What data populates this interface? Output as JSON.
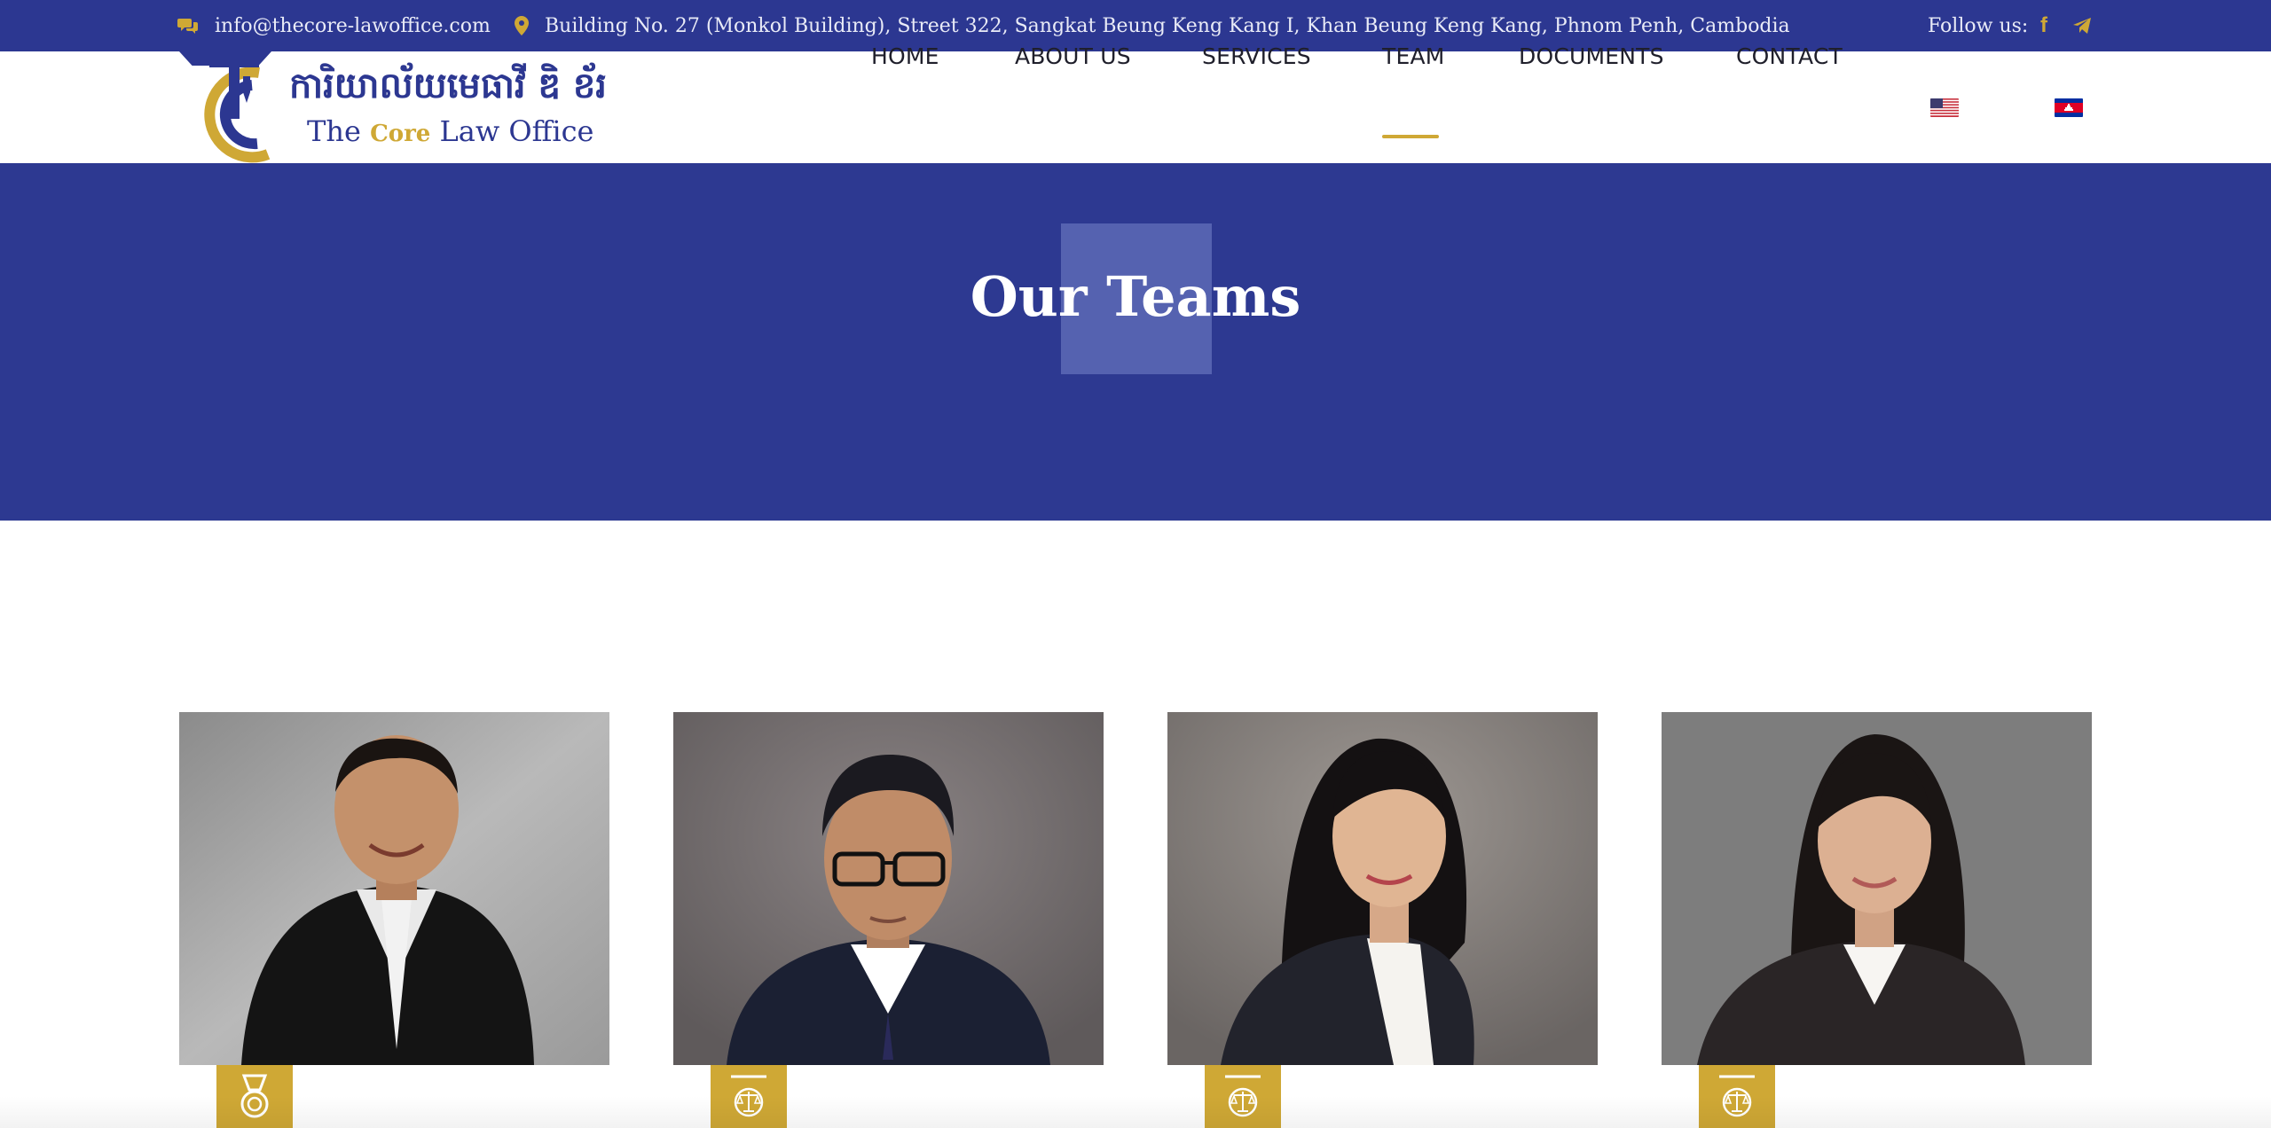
{
  "topbar": {
    "email": "info@thecore-lawoffice.com",
    "address": "Building No. 27 (Monkol Building), Street 322, Sangkat Beung Keng Kang I, Khan Beung Keng Kang, Phnom Penh, Cambodia",
    "follow_label": "Follow us:",
    "icons": {
      "email": "chat-bubbles-icon",
      "address": "map-pin-icon",
      "social": [
        "facebook-icon",
        "telegram-icon"
      ]
    }
  },
  "logo": {
    "khmer_name": "ការិយាល័យមេធាវី ឌិ ខ័រ",
    "english_prefix": "The",
    "english_core": "Core",
    "english_suffix": "Law Office"
  },
  "nav": {
    "items": [
      {
        "label": "HOME"
      },
      {
        "label": "ABOUT US"
      },
      {
        "label": "SERVICES"
      },
      {
        "label": "TEAM",
        "active": true
      },
      {
        "label": "DOCUMENTS"
      },
      {
        "label": "CONTACT"
      }
    ],
    "languages": [
      "us-flag-icon",
      "cambodia-flag-icon"
    ]
  },
  "hero": {
    "title": "Our Teams"
  },
  "team": {
    "members": [
      {
        "badge_icon": "medal-icon"
      },
      {
        "badge_icon": "scales-of-justice-icon"
      },
      {
        "badge_icon": "scales-of-justice-icon"
      },
      {
        "badge_icon": "scales-of-justice-icon"
      }
    ]
  },
  "colors": {
    "brand_blue": "#2c3791",
    "brand_gold": "#cfa835",
    "nav_text": "#1f1f2b"
  }
}
